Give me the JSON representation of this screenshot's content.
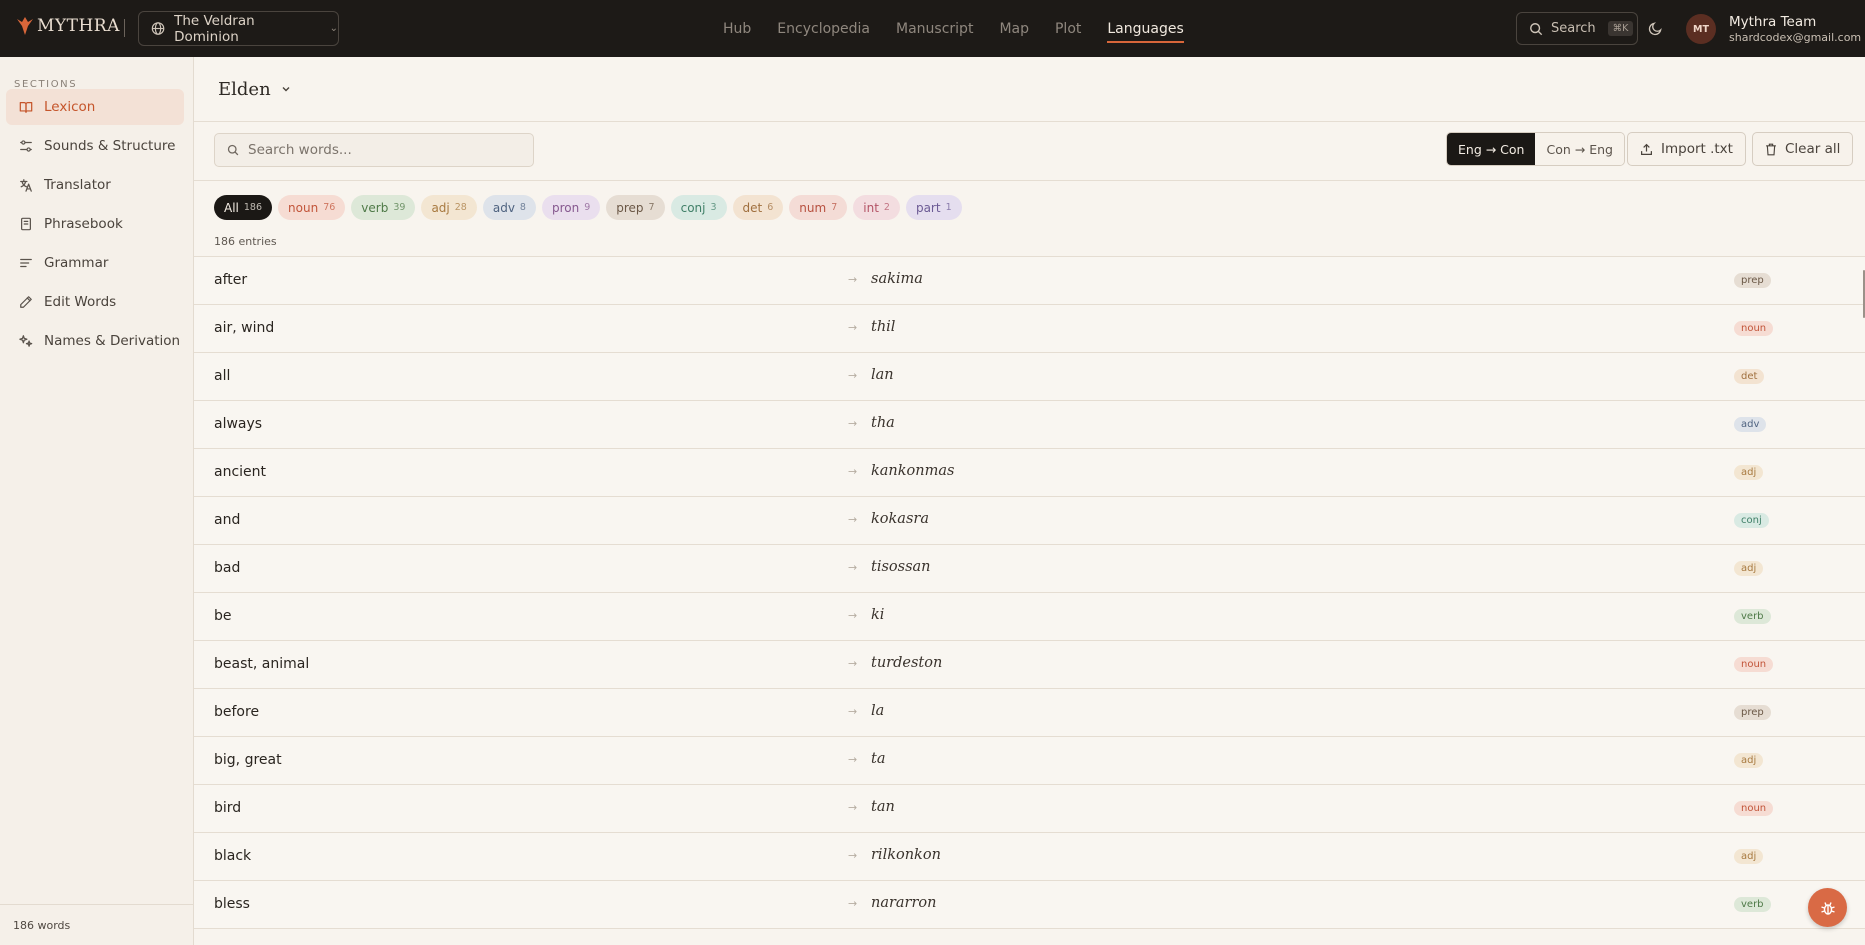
{
  "brand": {
    "name": "MYTHRA",
    "accent": "#d8663a"
  },
  "world": {
    "name": "The Veldran Dominion"
  },
  "nav": [
    {
      "label": "Hub",
      "active": false
    },
    {
      "label": "Encyclopedia",
      "active": false
    },
    {
      "label": "Manuscript",
      "active": false
    },
    {
      "label": "Map",
      "active": false
    },
    {
      "label": "Plot",
      "active": false
    },
    {
      "label": "Languages",
      "active": true
    }
  ],
  "search": {
    "label": "Search",
    "shortcut": "⌘K"
  },
  "user": {
    "initials": "MT",
    "name": "Mythra Team",
    "email": "shardcodex@gmail.com"
  },
  "sidebar": {
    "title": "SECTIONS",
    "items": [
      {
        "label": "Lexicon",
        "icon": "book-open-icon",
        "active": true
      },
      {
        "label": "Sounds & Structure",
        "icon": "sliders-icon",
        "active": false
      },
      {
        "label": "Translator",
        "icon": "translate-icon",
        "active": false
      },
      {
        "label": "Phrasebook",
        "icon": "notebook-icon",
        "active": false
      },
      {
        "label": "Grammar",
        "icon": "text-lines-icon",
        "active": false
      },
      {
        "label": "Edit Words",
        "icon": "pencil-icon",
        "active": false
      },
      {
        "label": "Names & Derivation",
        "icon": "sparkle-icon",
        "active": false
      }
    ],
    "footer": "186 words"
  },
  "language": {
    "name": "Elden"
  },
  "toolbar": {
    "search_placeholder": "Search words...",
    "direction": [
      {
        "label": "Eng → Con",
        "active": true
      },
      {
        "label": "Con → Eng",
        "active": false
      }
    ],
    "import_label": "Import .txt",
    "clear_label": "Clear all"
  },
  "filters": [
    {
      "label": "All",
      "count": "186",
      "bg": "#1b1815",
      "fg": "#f4ede4"
    },
    {
      "label": "noun",
      "count": "76",
      "bg": "#f6dcd3",
      "fg": "#c2553a"
    },
    {
      "label": "verb",
      "count": "39",
      "bg": "#dde8d8",
      "fg": "#4f7a48"
    },
    {
      "label": "adj",
      "count": "28",
      "bg": "#f3e6d2",
      "fg": "#a87a40"
    },
    {
      "label": "adv",
      "count": "8",
      "bg": "#dee3ea",
      "fg": "#4f6380"
    },
    {
      "label": "pron",
      "count": "9",
      "bg": "#eadfee",
      "fg": "#86588f"
    },
    {
      "label": "prep",
      "count": "7",
      "bg": "#e6ddd3",
      "fg": "#6b5846"
    },
    {
      "label": "conj",
      "count": "3",
      "bg": "#d9eae3",
      "fg": "#3f7f67"
    },
    {
      "label": "det",
      "count": "6",
      "bg": "#f3e3d1",
      "fg": "#a0703f"
    },
    {
      "label": "num",
      "count": "7",
      "bg": "#f4dcd6",
      "fg": "#b7503f"
    },
    {
      "label": "int",
      "count": "2",
      "bg": "#f3dde0",
      "fg": "#b45467"
    },
    {
      "label": "part",
      "count": "1",
      "bg": "#e5deef",
      "fg": "#6c5b95"
    }
  ],
  "entries_count": "186 entries",
  "entries": [
    {
      "english": "after",
      "conlang": "sakima",
      "pos": "prep"
    },
    {
      "english": "air, wind",
      "conlang": "thil",
      "pos": "noun"
    },
    {
      "english": "all",
      "conlang": "lan",
      "pos": "det"
    },
    {
      "english": "always",
      "conlang": "tha",
      "pos": "adv"
    },
    {
      "english": "ancient",
      "conlang": "kankonmas",
      "pos": "adj"
    },
    {
      "english": "and",
      "conlang": "kokasra",
      "pos": "conj"
    },
    {
      "english": "bad",
      "conlang": "tisossan",
      "pos": "adj"
    },
    {
      "english": "be",
      "conlang": "ki",
      "pos": "verb"
    },
    {
      "english": "beast, animal",
      "conlang": "turdeston",
      "pos": "noun"
    },
    {
      "english": "before",
      "conlang": "la",
      "pos": "prep"
    },
    {
      "english": "big, great",
      "conlang": "ta",
      "pos": "adj"
    },
    {
      "english": "bird",
      "conlang": "tan",
      "pos": "noun"
    },
    {
      "english": "black",
      "conlang": "rilkonkon",
      "pos": "adj"
    },
    {
      "english": "bless",
      "conlang": "nararron",
      "pos": "verb"
    }
  ],
  "pos_colors": {
    "noun": {
      "bg": "#f6dcd3",
      "fg": "#c2553a"
    },
    "verb": {
      "bg": "#dde8d8",
      "fg": "#4f7a48"
    },
    "adj": {
      "bg": "#f3e6d2",
      "fg": "#a87a40"
    },
    "adv": {
      "bg": "#dee3ea",
      "fg": "#4f6380"
    },
    "prep": {
      "bg": "#e6ddd3",
      "fg": "#6b5846"
    },
    "conj": {
      "bg": "#d9eae3",
      "fg": "#3f7f67"
    },
    "det": {
      "bg": "#f3e3d1",
      "fg": "#a0703f"
    }
  },
  "fab": {
    "icon": "bug-icon"
  }
}
